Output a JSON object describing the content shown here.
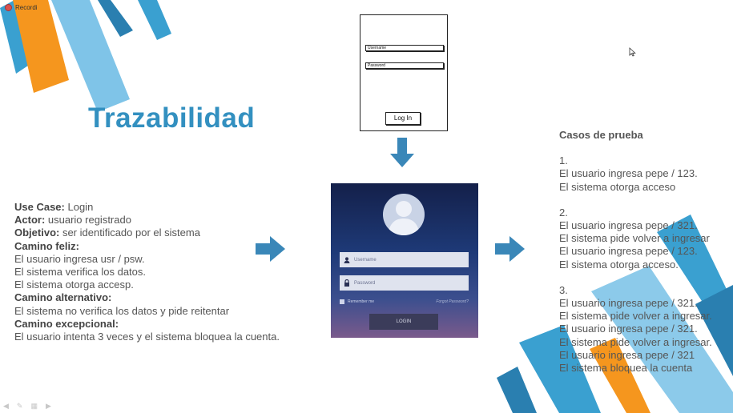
{
  "recording": {
    "label": "Recordi"
  },
  "slide": {
    "title": "Trazabilidad"
  },
  "wireframe": {
    "username_label": "Username",
    "password_label": "Password",
    "login_button": "Log In"
  },
  "mockup": {
    "username_placeholder": "Username",
    "password_placeholder": "Password",
    "remember_me": "Remember me",
    "forgot_password": "Forgot Password?",
    "login_button": "LOGIN"
  },
  "use_case": {
    "use_case_label": "Use Case:",
    "use_case_value": " Login",
    "actor_label": "Actor:",
    "actor_value": " usuario registrado",
    "objective_label": "Objetivo:",
    "objective_value": " ser identificado por el sistema",
    "happy_path_label": "Camino feliz:",
    "happy_path": [
      "El usuario ingresa usr / psw.",
      "El sistema verifica  los datos.",
      "El sistema otorga accesp."
    ],
    "alternative_label": "Camino alternativo:",
    "alternative": [
      "El sistema no verifica  los datos y pide reitentar"
    ],
    "exception_label": "Camino excepcional:",
    "exception": [
      "El usuario intenta 3 veces y el sistema bloquea la cuenta."
    ]
  },
  "test_cases": {
    "heading": "Casos de prueba",
    "case1_num": "1.",
    "case1": [
      "El usuario ingresa pepe / 123.",
      "El sistema otorga acceso"
    ],
    "case2_num": "2.",
    "case2": [
      "El usuario ingresa pepe / 321.",
      "El sistema pide volver  a ingresar",
      "El usuario ingresa pepe / 123.",
      "El sistema otorga acceso."
    ],
    "case3_num": "3.",
    "case3": [
      "El usuario ingresa pepe / 321.",
      "El sistema pide volver  a ingresar.",
      "El usuario ingresa pepe / 321.",
      "El sistema pide volver  a ingresar.",
      "El usuario ingresa pepe / 321",
      "El sistema bloquea la cuenta"
    ]
  },
  "colors": {
    "title": "#3390c0",
    "arrow": "#3a87b8",
    "stripe_light": "#7fc4e8",
    "stripe_mid": "#3aa0d0",
    "stripe_dark": "#2a7fb0",
    "stripe_orange": "#f5961e"
  }
}
